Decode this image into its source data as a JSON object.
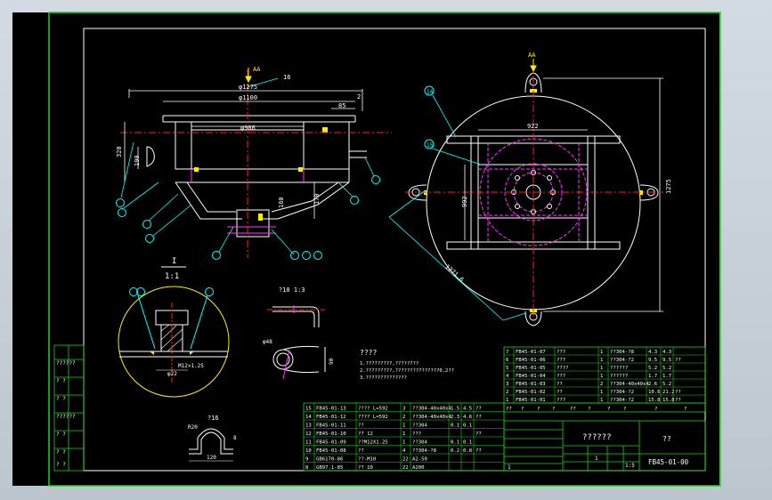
{
  "drawing": {
    "view_label_top": "AA",
    "view_label_right": "AA",
    "dim_top_1275": "φ1275",
    "dim_top_1100": "φ1100",
    "dim_top_986": "φ986",
    "dim_85": "85",
    "dim_2": "2",
    "dim_320": "320",
    "dim_190": "190",
    "dim_170": "170",
    "dim_160": "160",
    "balloon_16": "16",
    "right_dim_922": "922",
    "right_dim_992": "992",
    "right_dim_1275": "1275",
    "right_dim_diag": "1271.6",
    "detail_title": "I",
    "detail_scale": "1:1",
    "detail_m": "M12×1.25",
    "detail_d": "φ22",
    "part10_label": "?10  1:3",
    "part16_label": "?16",
    "part16_r20": "R20",
    "part16_dim": "120",
    "part16_side": "8",
    "spring_dim": "φ48",
    "spring_h": "90"
  },
  "notes": {
    "title": "????",
    "lines": [
      "1.?????????,????????",
      "2.?????????,???????????????0,2??",
      "3.??????????????"
    ]
  },
  "bom_upper": [
    [
      "7",
      "FB45-01-07",
      "???",
      "1",
      "??304-?8",
      "4.3",
      "4.3",
      ""
    ],
    [
      "6",
      "FB45-01-06",
      "???",
      "1",
      "??304-?2",
      "9.5",
      "9.5",
      "??"
    ],
    [
      "5",
      "FB45-01-05",
      "????",
      "1",
      "??????",
      "5.2",
      "5.2",
      ""
    ],
    [
      "4",
      "FB45-01-04",
      "???",
      "1",
      "??????",
      "1.7",
      "1.7",
      ""
    ],
    [
      "3",
      "FB45-01-03",
      "??",
      "2",
      "??304-40x40x4",
      "2.6",
      "5.2",
      ""
    ],
    [
      "2",
      "FB45-01-02",
      "??",
      "1",
      "??304-?2",
      "10.6",
      "21.2",
      "??"
    ],
    [
      "1",
      "FB45-01-01",
      "???",
      "1",
      "??304-?2",
      "15.8",
      "15.8",
      "??"
    ]
  ],
  "bom_upper_header": [
    "??",
    "?",
    "?",
    "?",
    "??",
    "?",
    "?",
    "?",
    "?",
    "?"
  ],
  "bom_lower": [
    [
      "15",
      "FB45-01-13",
      "????  L=592",
      "3",
      "??304-40x40x4",
      "1.5",
      "4.5",
      "??"
    ],
    [
      "14",
      "FB45-01-12",
      "????  L=592",
      "2",
      "??304-40x40x4",
      "2.3",
      "4.6",
      "??"
    ],
    [
      "13",
      "FB45-01-11",
      "??",
      "1",
      "??304",
      "0.1",
      "0.1",
      ""
    ],
    [
      "12",
      "FB45-01-10",
      "??    12",
      "1",
      "???",
      "",
      "",
      "??"
    ],
    [
      "11",
      "FB45-01-09",
      "??M12X1.25",
      "1",
      "??304",
      "0.1",
      "0.1",
      ""
    ],
    [
      "10",
      "FB45-01-08",
      "??",
      "4",
      "??304-?8",
      "0.2",
      "0.8",
      "??"
    ],
    [
      "9",
      "GB6170-86",
      "??-M10",
      "22",
      "A2-50",
      "",
      "",
      ""
    ],
    [
      "8",
      "GB97.1-85",
      "?? 10",
      "22",
      "A200",
      "",
      "",
      ""
    ]
  ],
  "title_block": {
    "drawing_name": "??????",
    "company": "??",
    "drawing_no": "FB45-01-00",
    "scale_a": "1",
    "scale_b": "1:5",
    "sheets": "1"
  },
  "left_stamp": [
    "??????",
    "?    ?",
    "?    ?",
    "??????",
    "?    ?",
    "?    ?",
    "?    ?"
  ]
}
